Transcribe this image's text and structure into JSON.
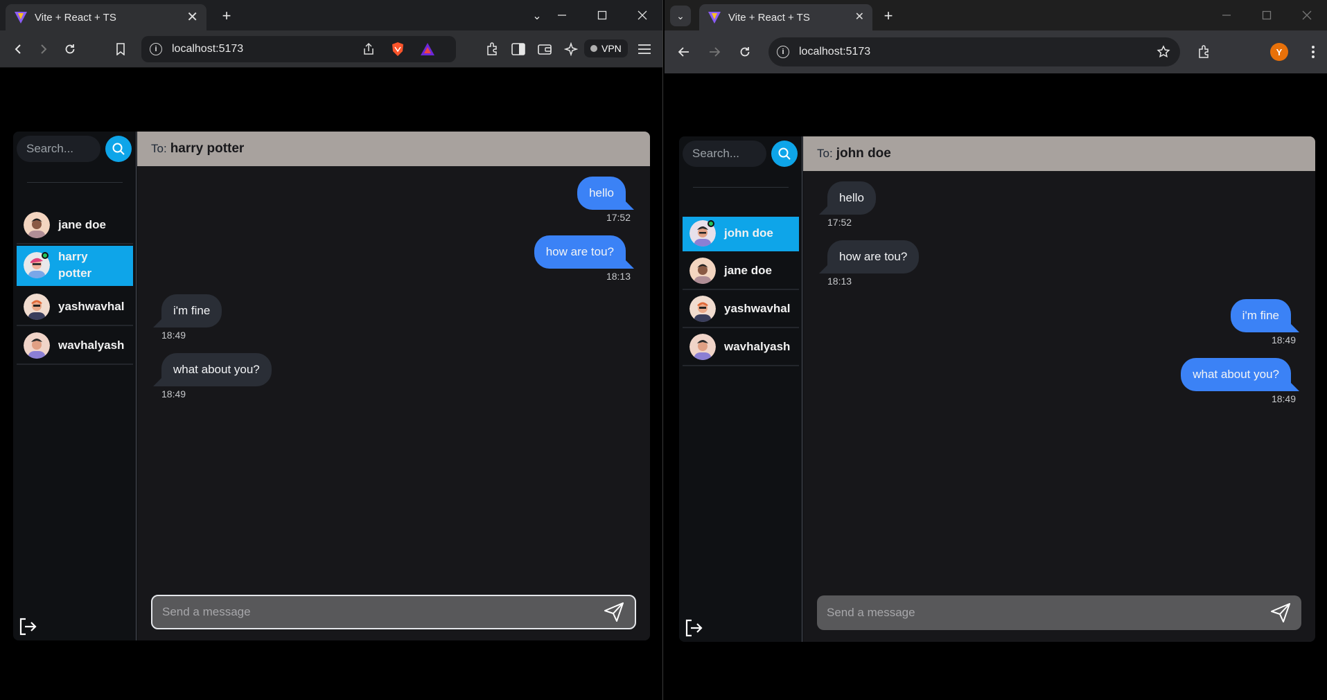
{
  "left_browser": {
    "tab_title": "Vite + React + TS",
    "url": "localhost:5173",
    "vpn_label": "VPN"
  },
  "right_browser": {
    "tab_title": "Vite + React + TS",
    "url": "localhost:5173",
    "profile_initial": "Y"
  },
  "left_chat": {
    "search_placeholder": "Search...",
    "to_prefix": "To:",
    "recipient": "harry potter",
    "contacts": [
      {
        "name": "jane doe",
        "active": false,
        "online": false
      },
      {
        "name": "harry potter",
        "active": true,
        "online": true
      },
      {
        "name": "yashwavhal",
        "active": false,
        "online": false
      },
      {
        "name": "wavhalyash",
        "active": false,
        "online": false
      }
    ],
    "messages": [
      {
        "text": "hello",
        "time": "17:52",
        "direction": "out"
      },
      {
        "text": "how are tou?",
        "time": "18:13",
        "direction": "out"
      },
      {
        "text": "i'm fine",
        "time": "18:49",
        "direction": "in"
      },
      {
        "text": "what about you?",
        "time": "18:49",
        "direction": "in"
      }
    ],
    "composer_placeholder": "Send a message"
  },
  "right_chat": {
    "search_placeholder": "Search...",
    "to_prefix": "To:",
    "recipient": "john doe",
    "contacts": [
      {
        "name": "john doe",
        "active": true,
        "online": true
      },
      {
        "name": "jane doe",
        "active": false,
        "online": false
      },
      {
        "name": "yashwavhal",
        "active": false,
        "online": false
      },
      {
        "name": "wavhalyash",
        "active": false,
        "online": false
      }
    ],
    "messages": [
      {
        "text": "hello",
        "time": "17:52",
        "direction": "in"
      },
      {
        "text": "how are tou?",
        "time": "18:13",
        "direction": "in"
      },
      {
        "text": "i'm fine",
        "time": "18:49",
        "direction": "out"
      },
      {
        "text": "what about you?",
        "time": "18:49",
        "direction": "out"
      }
    ],
    "composer_placeholder": "Send a message"
  },
  "colors": {
    "accent": "#0ea5e9",
    "outgoing_bubble": "#3b82f6",
    "incoming_bubble": "#2a2e36",
    "header_bar": "#a8a29e",
    "online_dot": "#22c55e"
  }
}
